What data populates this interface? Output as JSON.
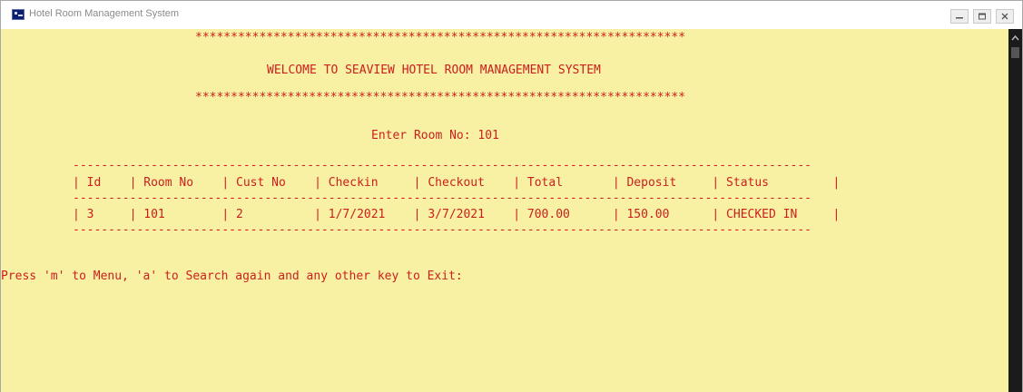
{
  "window": {
    "title": "Hotel Room Management System",
    "controls": [
      "minimize",
      "maximize",
      "close"
    ]
  },
  "console": {
    "banner_top": "*********************************************************************",
    "welcome": "WELCOME TO SEAVIEW HOTEL ROOM MANAGEMENT SYSTEM",
    "banner_bottom": "*********************************************************************",
    "prompt_room": "Enter Room No: 101",
    "table": {
      "rule_top": "--------------------------------------------------------------------------------------------------------",
      "header": "| Id    | Room No    | Cust No    | Checkin     | Checkout    | Total       | Deposit     | Status         |",
      "rule_mid": "--------------------------------------------------------------------------------------------------------",
      "rows": [
        "| 3     | 101        | 2          | 1/7/2021    | 3/7/2021    | 700.00      | 150.00      | CHECKED IN     |"
      ],
      "rule_bottom": "--------------------------------------------------------------------------------------------------------"
    },
    "footer_prompt": "Press 'm' to Menu, 'a' to Search again and any other key to Exit:"
  },
  "colors": {
    "console_bg": "#f8f0a2",
    "console_text": "#cc1f1f",
    "scrollbar": "#1b1b1b"
  }
}
